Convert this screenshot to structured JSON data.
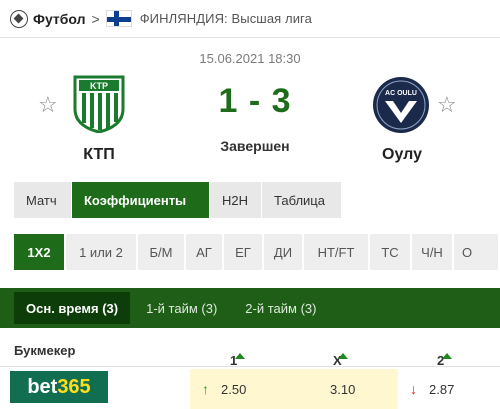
{
  "breadcrumb": {
    "sport": "Футбол",
    "separator": ">",
    "league": "ФИНЛЯНДИЯ: Высшая лига"
  },
  "match": {
    "datetime": "15.06.2021 18:30",
    "home_team": "КТП",
    "away_team": "Оулу",
    "home_logo_text": "KTP",
    "away_logo_text": "AC OULU",
    "score": "1 - 3",
    "status": "Завершен"
  },
  "tabs": [
    {
      "label": "Матч",
      "active": false
    },
    {
      "label": "Коэффициенты",
      "active": true
    },
    {
      "label": "H2H",
      "active": false
    },
    {
      "label": "Таблица",
      "active": false
    }
  ],
  "markets": [
    {
      "label": "1X2",
      "active": true
    },
    {
      "label": "1 или 2",
      "active": false
    },
    {
      "label": "Б/М",
      "active": false
    },
    {
      "label": "АГ",
      "active": false
    },
    {
      "label": "ЕГ",
      "active": false
    },
    {
      "label": "ДИ",
      "active": false
    },
    {
      "label": "HT/FT",
      "active": false
    },
    {
      "label": "ТС",
      "active": false
    },
    {
      "label": "Ч/Н",
      "active": false
    },
    {
      "label": "О",
      "active": false
    }
  ],
  "periods": [
    {
      "label": "Осн. время (3)",
      "active": true
    },
    {
      "label": "1-й тайм (3)",
      "active": false
    },
    {
      "label": "2-й тайм (3)",
      "active": false
    }
  ],
  "odds_table": {
    "headers": {
      "bookmaker": "Букмекер",
      "home": "1",
      "draw": "X",
      "away": "2"
    },
    "rows": [
      {
        "bookmaker_logo_text_a": "bet",
        "bookmaker_logo_text_b": "365",
        "home": "2.50",
        "home_trend": "up",
        "draw": "3.10",
        "away": "2.87",
        "away_trend": "down"
      }
    ]
  },
  "colors": {
    "accent_green": "#1e6b19",
    "dark_green": "#0d3d09",
    "highlight_yellow": "#fff7cf",
    "up_arrow": "#27a327",
    "down_arrow": "#d42020"
  },
  "icons": {
    "sport": "soccer-ball-icon",
    "country_flag": "finland-flag-icon",
    "favorite": "star-outline-icon",
    "sort": "caret-up-icon",
    "trend_up": "arrow-up-icon",
    "trend_down": "arrow-down-icon"
  }
}
